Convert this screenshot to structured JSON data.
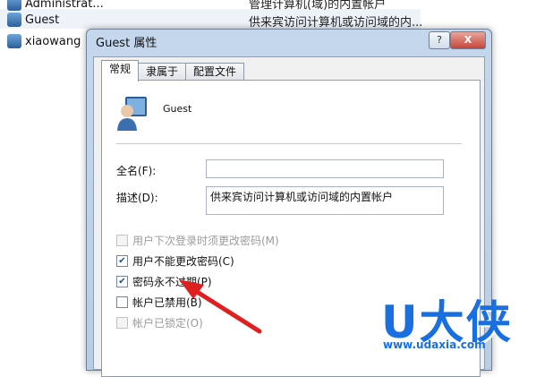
{
  "background_list": {
    "rows": [
      {
        "name": "Administrat...",
        "description": "管理计算机(域)的内置帐户"
      },
      {
        "name": "Guest",
        "description": "供来宾访问计算机或访问域的内..."
      },
      {
        "name": "xiaowang",
        "description": ""
      }
    ]
  },
  "dialog": {
    "title": "Guest 属性",
    "help_label": "?",
    "close_label": "X",
    "tabs": [
      "常规",
      "隶属于",
      "配置文件"
    ],
    "active_tab": "常规",
    "user_name": "Guest",
    "full_name": {
      "label": "全名(F):",
      "value": ""
    },
    "description": {
      "label": "描述(D):",
      "value": "供来宾访问计算机或访问域的内置帐户"
    },
    "options": [
      {
        "label": "用户下次登录时须更改密码(M)",
        "checked": false,
        "enabled": false
      },
      {
        "label": "用户不能更改密码(C)",
        "checked": true,
        "enabled": true
      },
      {
        "label": "密码永不过期(P)",
        "checked": true,
        "enabled": true
      },
      {
        "label": "帐户已禁用(B)",
        "checked": false,
        "enabled": true
      },
      {
        "label": "帐户已锁定(O)",
        "checked": false,
        "enabled": false
      }
    ]
  },
  "annotation": {
    "arrow_color": "#e02020"
  },
  "watermark": {
    "brand": "U大侠",
    "url": "www.udaxia.com",
    "color": "#1a6fe0"
  }
}
